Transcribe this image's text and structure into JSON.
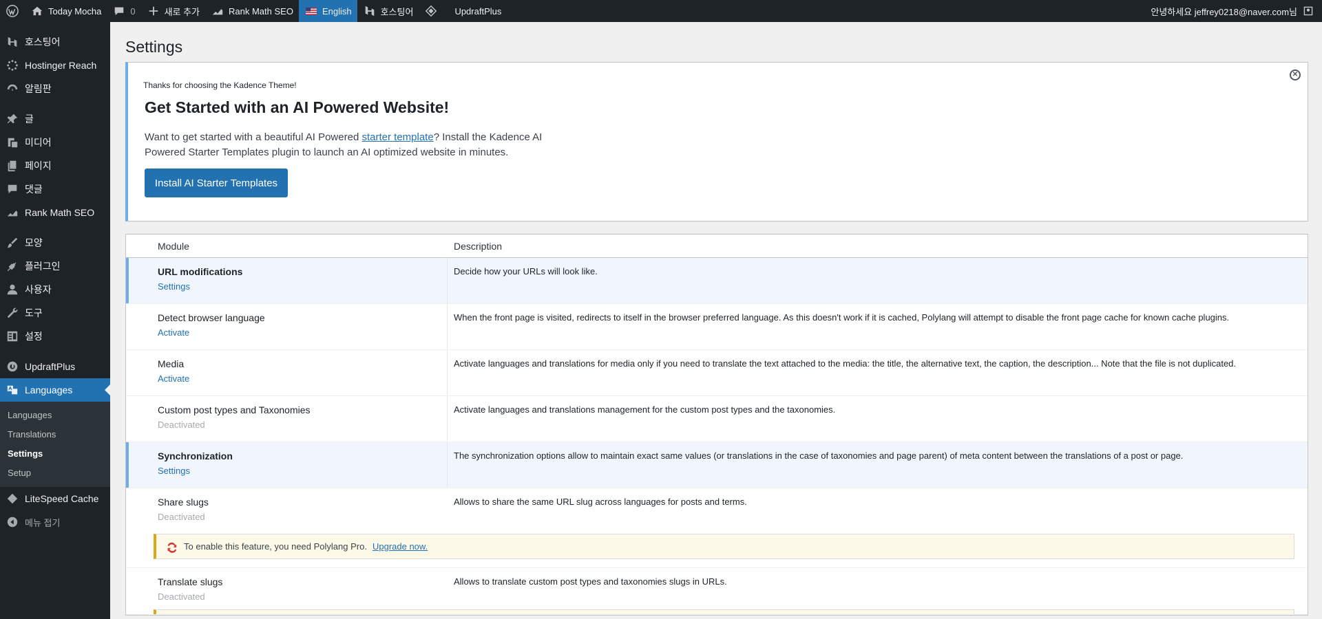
{
  "adminbar": {
    "site_name": "Today Mocha",
    "comments_count": "0",
    "new_label": "새로 추가",
    "rankmath_label": "Rank Math SEO",
    "language_label": "English",
    "hostinger_label": "호스팅어",
    "updraft_label": "UpdraftPlus",
    "greeting": "안녕하세요 jeffrey0218@naver.com님"
  },
  "sidebar": {
    "items": [
      {
        "label": "호스팅어",
        "icon": "hostinger-icon"
      },
      {
        "label": "Hostinger Reach",
        "icon": "spinner-icon"
      },
      {
        "label": "알림판",
        "icon": "dashboard-icon"
      },
      {
        "label": "글",
        "icon": "pin-icon"
      },
      {
        "label": "미디어",
        "icon": "media-icon"
      },
      {
        "label": "페이지",
        "icon": "page-icon"
      },
      {
        "label": "댓글",
        "icon": "comment-icon"
      },
      {
        "label": "Rank Math SEO",
        "icon": "rankmath-icon"
      },
      {
        "label": "모양",
        "icon": "brush-icon"
      },
      {
        "label": "플러그인",
        "icon": "plugin-icon"
      },
      {
        "label": "사용자",
        "icon": "user-icon"
      },
      {
        "label": "도구",
        "icon": "wrench-icon"
      },
      {
        "label": "설정",
        "icon": "settings-icon"
      },
      {
        "label": "UpdraftPlus",
        "icon": "updraft-icon"
      },
      {
        "label": "Languages",
        "icon": "translate-icon"
      },
      {
        "label": "LiteSpeed Cache",
        "icon": "litespeed-icon"
      },
      {
        "label": "메뉴 접기",
        "icon": "collapse-icon"
      }
    ],
    "submenu": [
      "Languages",
      "Translations",
      "Settings",
      "Setup"
    ]
  },
  "page": {
    "title": "Settings"
  },
  "notice": {
    "small": "Thanks for choosing the Kadence Theme!",
    "heading": "Get Started with an AI Powered Website!",
    "text_before": "Want to get started with a beautiful AI Powered ",
    "link": "starter template",
    "text_after": "? Install the Kadence AI Powered Starter Templates plugin to launch an AI optimized website in minutes.",
    "button": "Install AI Starter Templates"
  },
  "table": {
    "headers": {
      "module": "Module",
      "description": "Description"
    },
    "rows": [
      {
        "name": "URL modifications",
        "action": "Settings",
        "description": "Decide how your URLs will look like."
      },
      {
        "name": "Detect browser language",
        "action": "Activate",
        "description": "When the front page is visited, redirects to itself in the browser preferred language. As this doesn't work if it is cached, Polylang will attempt to disable the front page cache for known cache plugins."
      },
      {
        "name": "Media",
        "action": "Activate",
        "description": "Activate languages and translations for media only if you need to translate the text attached to the media: the title, the alternative text, the caption, the description... Note that the file is not duplicated."
      },
      {
        "name": "Custom post types and Taxonomies",
        "action": "Deactivated",
        "description": "Activate languages and translations management for the custom post types and the taxonomies."
      },
      {
        "name": "Synchronization",
        "action": "Settings",
        "description": "The synchronization options allow to maintain exact same values (or translations in the case of taxonomies and page parent) of meta content between the translations of a post or page."
      },
      {
        "name": "Share slugs",
        "action": "Deactivated",
        "description": "Allows to share the same URL slug across languages for posts and terms."
      },
      {
        "name": "Translate slugs",
        "action": "Deactivated",
        "description": "Allows to translate custom post types and taxonomies slugs in URLs."
      }
    ],
    "pro_notice_text": "To enable this feature, you need Polylang Pro.",
    "pro_notice_link": "Upgrade now."
  }
}
